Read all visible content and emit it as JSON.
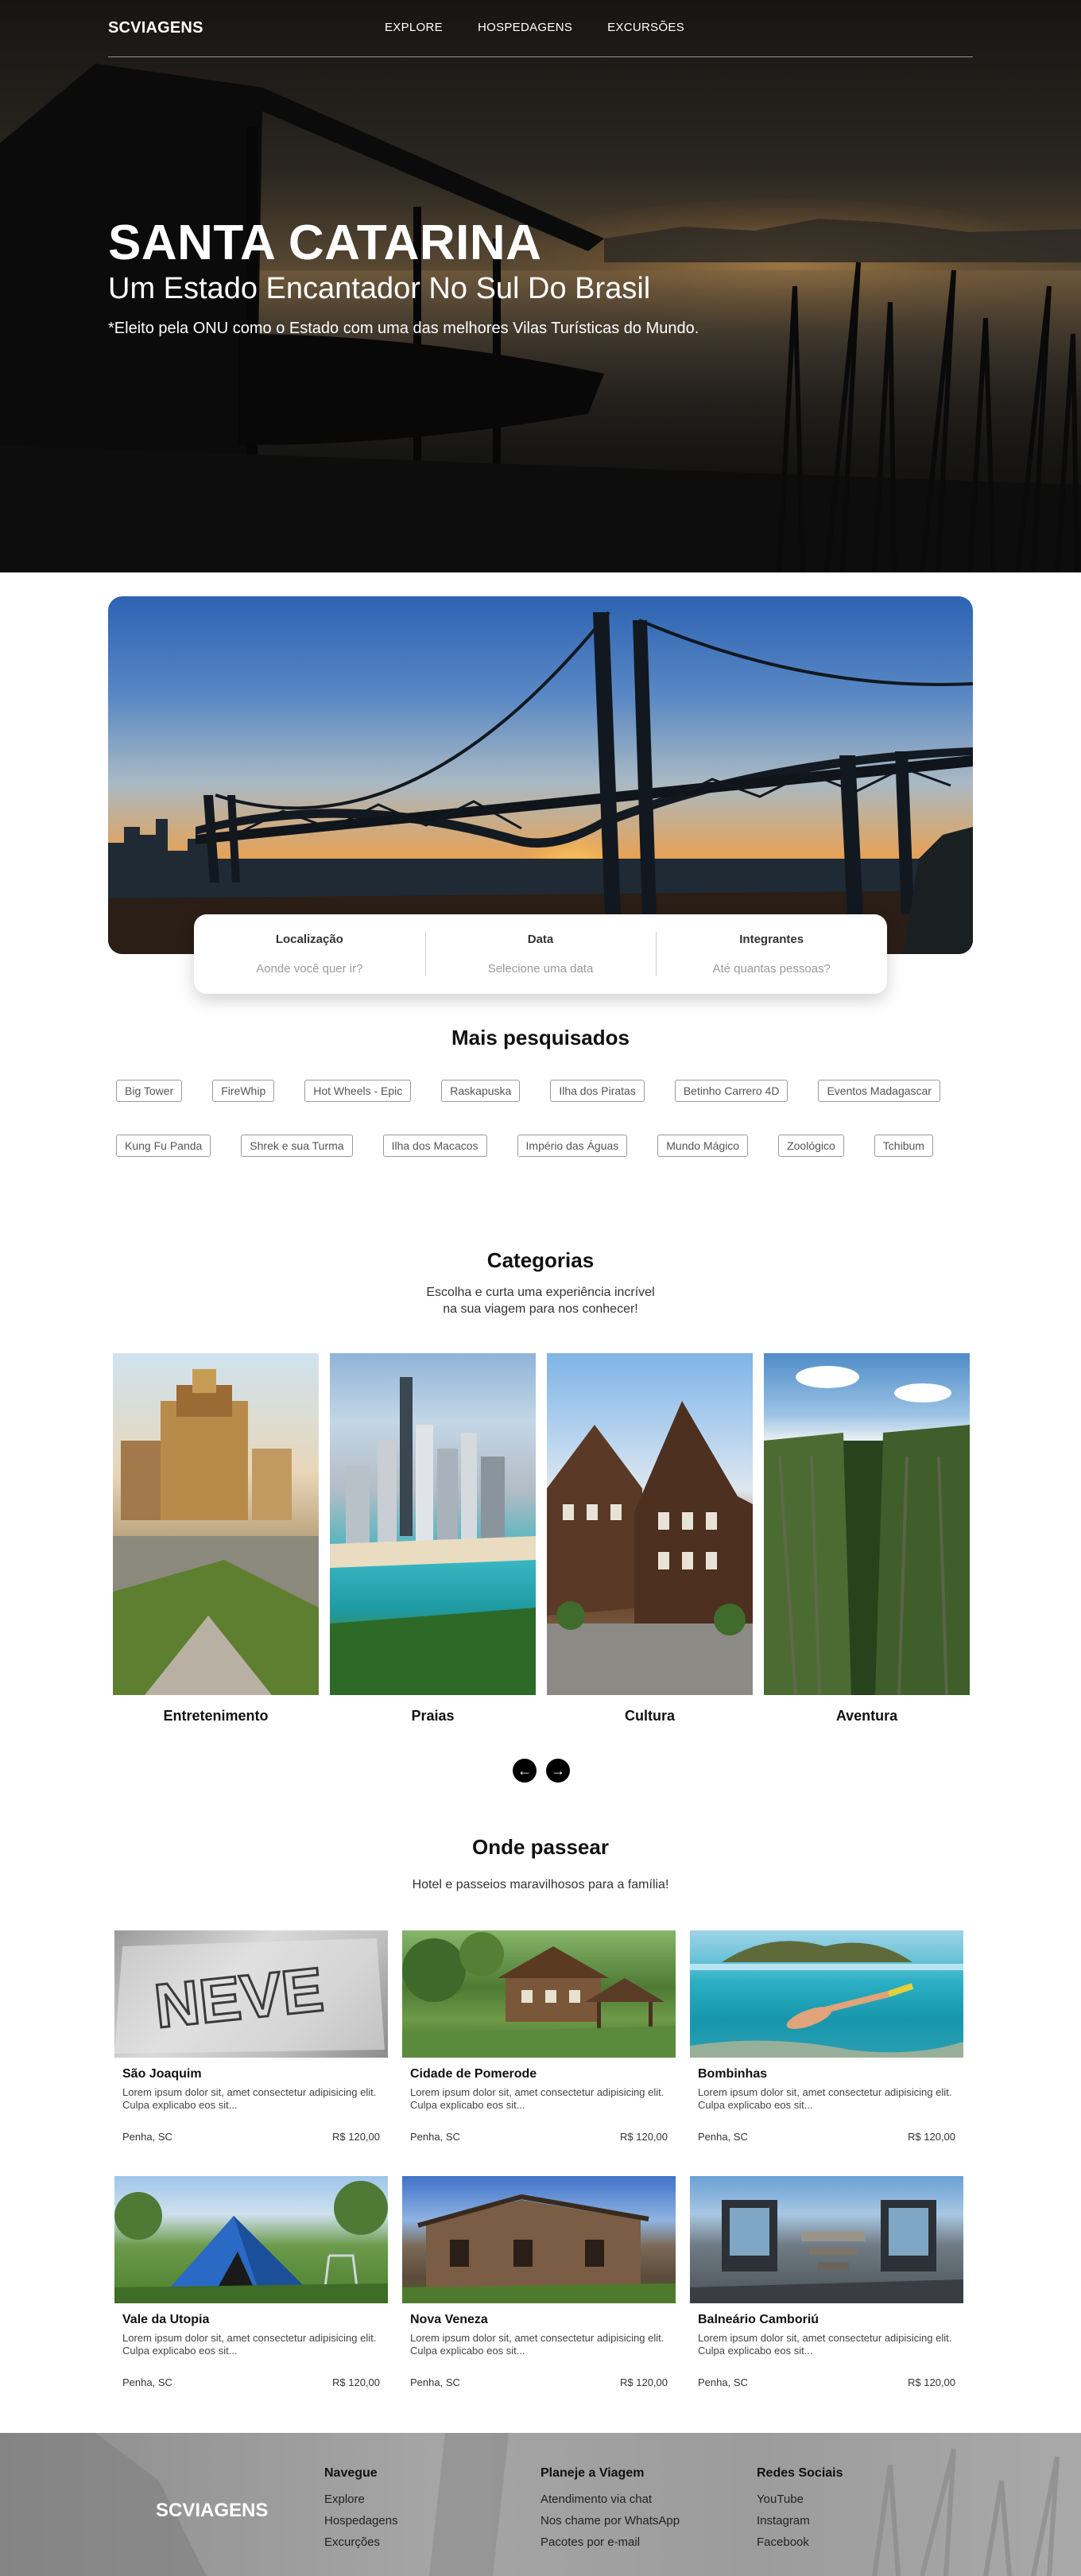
{
  "nav": {
    "logo": "SCVIAGENS",
    "links": [
      "EXPLORE",
      "HOSPEDAGENS",
      "EXCURSÕES"
    ]
  },
  "hero": {
    "title": "SANTA CATARINA",
    "subtitle": "Um Estado Encantador No Sul Do Brasil",
    "note": "*Eleito pela ONU como o Estado com uma das melhores Vilas Turísticas do Mundo."
  },
  "search": {
    "fields": [
      {
        "label": "Localização",
        "placeholder": "Aonde você quer ir?"
      },
      {
        "label": "Data",
        "placeholder": "Selecione uma data"
      },
      {
        "label": "Integrantes",
        "placeholder": "Até quantas pessoas?"
      }
    ]
  },
  "most_searched": {
    "title": "Mais pesquisados",
    "row1": [
      "Big Tower",
      "FireWhip",
      "Hot Wheels - Epic",
      "Raskapuska",
      "Ilha dos Piratas",
      "Betinho Carrero 4D",
      "Eventos Madagascar"
    ],
    "row2": [
      "Kung Fu Panda",
      "Shrek e sua Turma",
      "Ilha dos Macacos",
      "Império das Águas",
      "Mundo Mágico",
      "Zoológico",
      "Tchibum"
    ]
  },
  "categories": {
    "title": "Categorias",
    "desc_line1": "Escolha e curta uma experiência incrível",
    "desc_line2": "na sua viagem para nos conhecer!",
    "items": [
      "Entretenimento",
      "Praias",
      "Cultura",
      "Aventura"
    ],
    "prev_icon": "arrow-left-icon",
    "next_icon": "arrow-right-icon",
    "prev_glyph": "←",
    "next_glyph": "→"
  },
  "places": {
    "title": "Onde passear",
    "subtitle": "Hotel e passeios maravilhosos para a família!",
    "cards": [
      {
        "name": "São Joaquim",
        "text": "Lorem ipsum dolor sit, amet consectetur adipisicing elit. Culpa explicabo eos sit...",
        "location": "Penha, SC",
        "price": "R$ 120,00"
      },
      {
        "name": "Cidade de Pomerode",
        "text": "Lorem ipsum dolor sit, amet consectetur adipisicing elit. Culpa explicabo eos sit...",
        "location": "Penha, SC",
        "price": "R$ 120,00"
      },
      {
        "name": "Bombinhas",
        "text": "Lorem ipsum dolor sit, amet consectetur adipisicing elit. Culpa explicabo eos sit...",
        "location": "Penha, SC",
        "price": "R$ 120,00"
      },
      {
        "name": "Vale da Utopia",
        "text": "Lorem ipsum dolor sit, amet consectetur adipisicing elit. Culpa explicabo eos sit...",
        "location": "Penha, SC",
        "price": "R$ 120,00"
      },
      {
        "name": "Nova Veneza",
        "text": "Lorem ipsum dolor sit, amet consectetur adipisicing elit. Culpa explicabo eos sit...",
        "location": "Penha, SC",
        "price": "R$ 120,00"
      },
      {
        "name": "Balneário Camboriú",
        "text": "Lorem ipsum dolor sit, amet consectetur adipisicing elit. Culpa explicabo eos sit...",
        "location": "Penha, SC",
        "price": "R$ 120,00"
      }
    ],
    "snow_word": "NEVE"
  },
  "footer": {
    "logo": "SCVIAGENS",
    "columns": [
      {
        "title": "Navegue",
        "links": [
          "Explore",
          "Hospedagens",
          "Excurções"
        ]
      },
      {
        "title": "Planeje a Viagem",
        "links": [
          "Atendimento via chat",
          "Nos chame por WhatsApp",
          "Pacotes por e-mail"
        ]
      },
      {
        "title": "Redes Sociais",
        "links": [
          "YouTube",
          "Instagram",
          "Facebook"
        ]
      }
    ]
  },
  "colors": {
    "accent": "#000000",
    "tag_border": "#9a9a9a",
    "footer_bg": "#9c9c9c"
  }
}
